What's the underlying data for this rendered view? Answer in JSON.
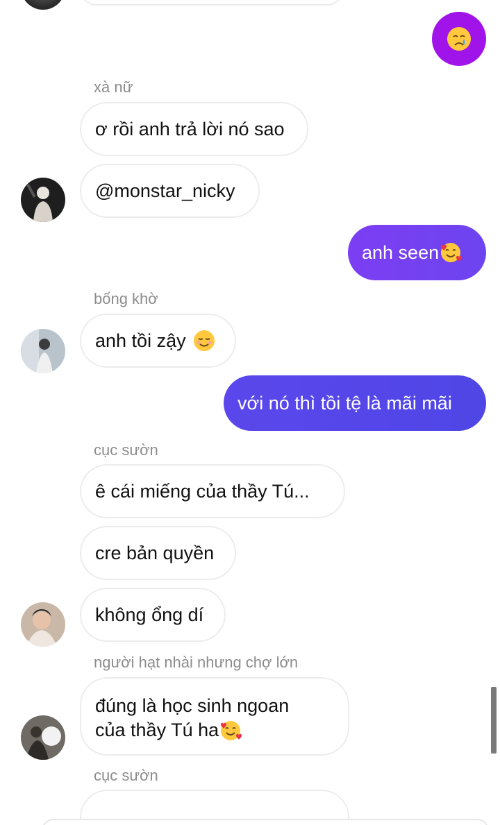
{
  "messages": {
    "m1": {
      "sender": "xà nữ",
      "text": "ơ rồi anh trả lời nó sao"
    },
    "m2": {
      "text": "@monstar_nicky"
    },
    "m3": {
      "text": "anh seen"
    },
    "m4": {
      "sender": "bống khờ",
      "text": "anh tồi zậy"
    },
    "m5": {
      "text": "với nó thì tồi tệ là mãi mãi"
    },
    "m6": {
      "sender": "cục sườn",
      "text": "ê cái miếng của thầy Tú..."
    },
    "m7": {
      "text": "cre bản quyền"
    },
    "m8": {
      "text": "không ổng dí"
    },
    "m9": {
      "sender": "người hạt nhài nhưng chợ lớn",
      "line1": "đúng là học sinh ngoan",
      "line2": "của thầy Tú ha"
    },
    "m10": {
      "sender": "cục sườn"
    }
  },
  "colors": {
    "outgoing_top": "#7b3ff2",
    "outgoing_bottom": "#5046e8",
    "reaction_circle": "#a014ea"
  },
  "icons": {
    "reaction": "crying-face-emoji",
    "love": "smiling-face-with-hearts-emoji",
    "blush": "smiling-face-emoji"
  }
}
